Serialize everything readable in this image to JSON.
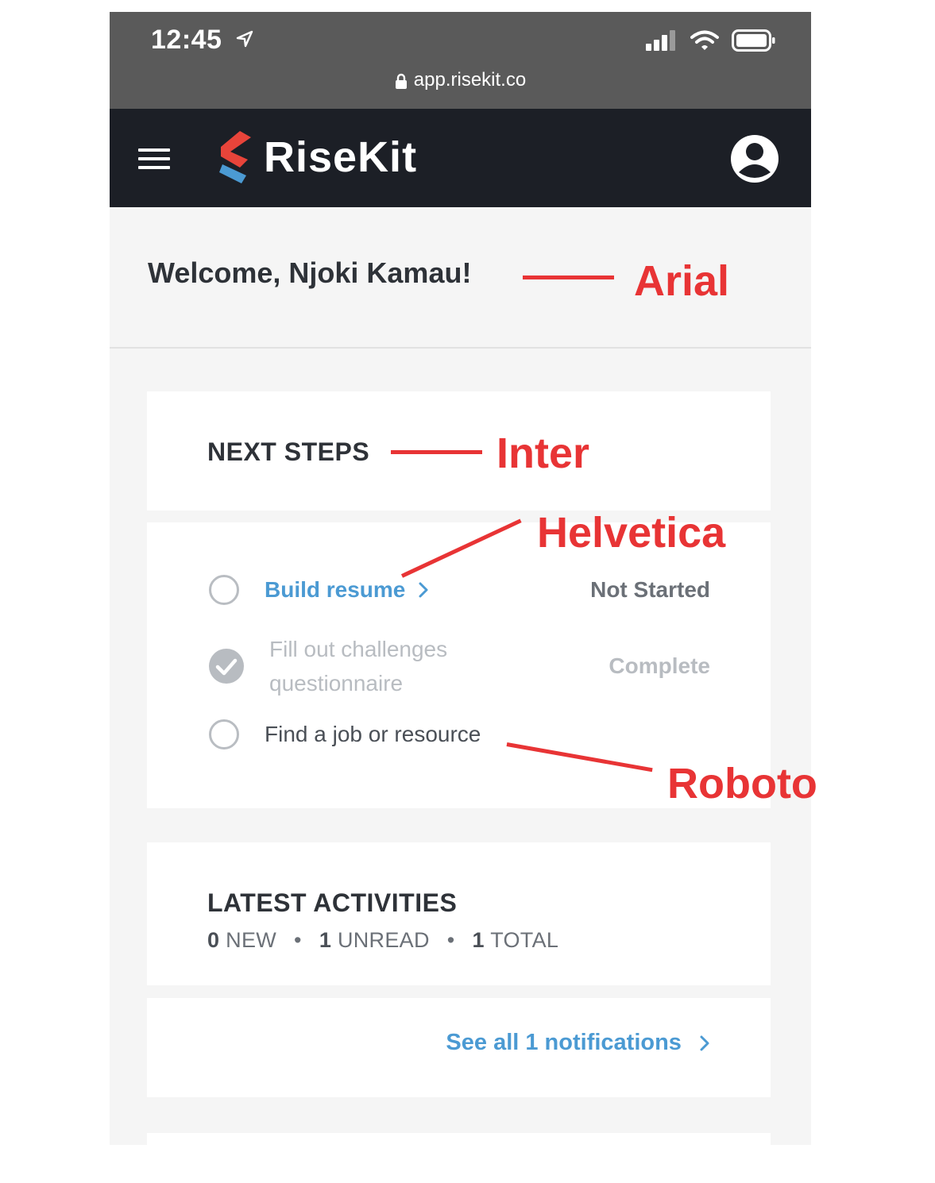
{
  "status_bar": {
    "time": "12:45",
    "url": "app.risekit.co"
  },
  "header": {
    "brand": "RiseKit",
    "colors": {
      "bar": "#1c1f26",
      "logo_red": "#e8443a",
      "logo_blue": "#4b9ad3"
    }
  },
  "welcome": {
    "text": "Welcome, Njoki Kamau!"
  },
  "next_steps": {
    "title": "NEXT STEPS",
    "items": [
      {
        "label": "Build resume",
        "status": "Not Started",
        "state": "not-started"
      },
      {
        "label": "Fill out challenges questionnaire",
        "line1": "Fill out challenges",
        "line2": "questionnaire",
        "status": "Complete",
        "state": "complete"
      },
      {
        "label": "Find a job or resource",
        "status": "",
        "state": "not-started"
      }
    ]
  },
  "latest_activities": {
    "title": "LATEST ACTIVITIES",
    "new_count": "0",
    "new_label": "NEW",
    "unread_count": "1",
    "unread_label": "UNREAD",
    "total_count": "1",
    "total_label": "TOTAL",
    "see_all": "See all 1 notifications"
  },
  "annotations": [
    "Arial",
    "Inter",
    "Helvetica",
    "Roboto"
  ],
  "annotation_color": "#e83435"
}
